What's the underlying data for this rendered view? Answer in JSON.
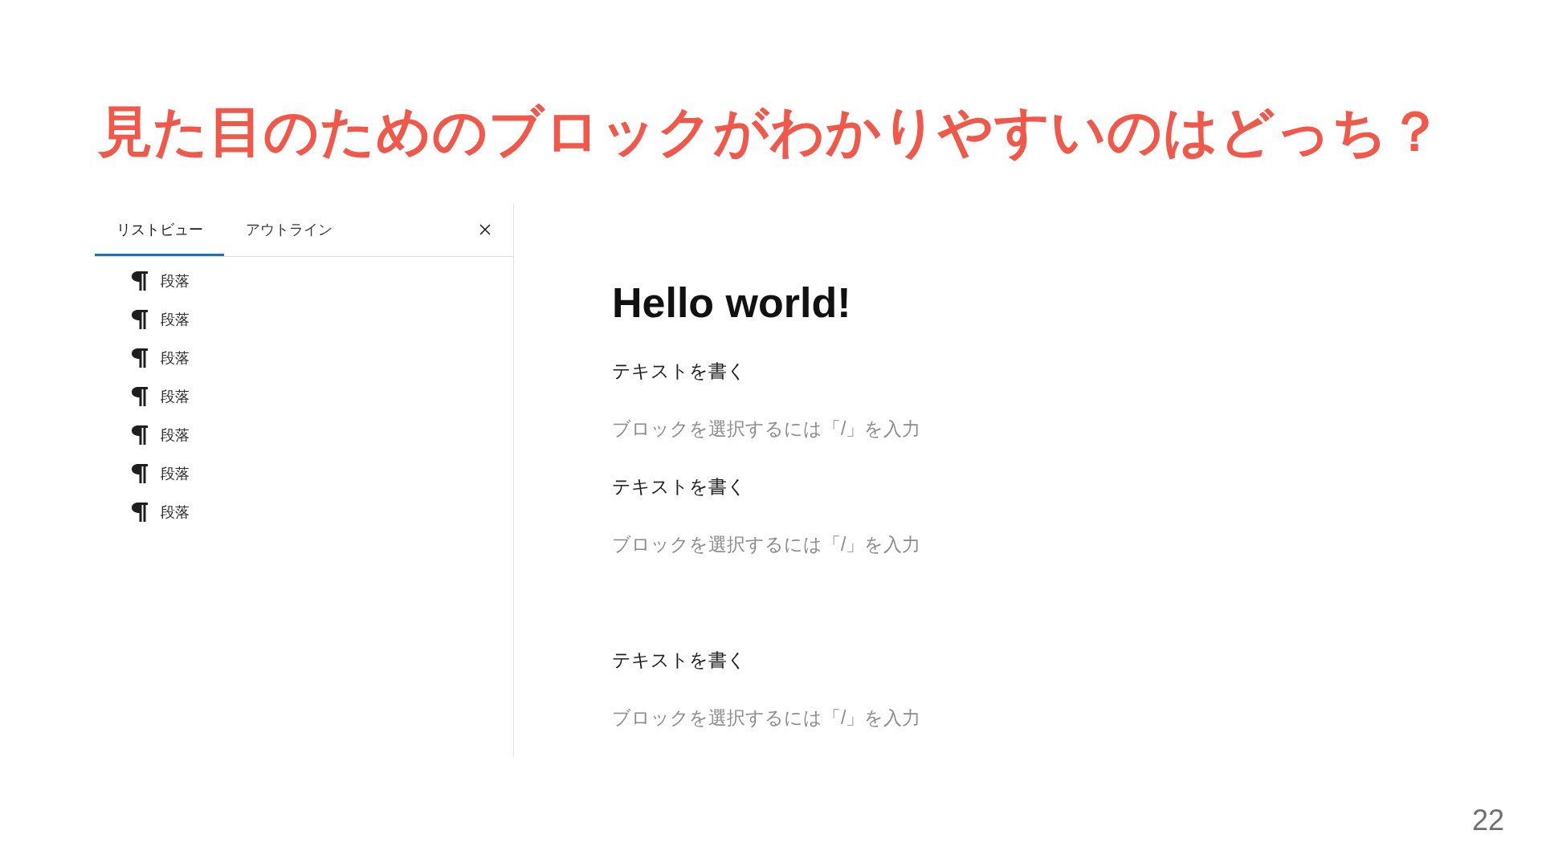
{
  "title": "見た目のためのブロックがわかりやすいのはどっち？",
  "list_view": {
    "tabs": [
      {
        "label": "リストビュー",
        "selected": true
      },
      {
        "label": "アウトライン",
        "selected": false
      }
    ],
    "items": [
      {
        "label": "段落",
        "selected": false
      },
      {
        "label": "段落",
        "selected": false
      },
      {
        "label": "段落",
        "selected": false
      },
      {
        "label": "段落",
        "selected": false
      },
      {
        "label": "段落",
        "selected": false
      },
      {
        "label": "段落",
        "selected": false
      },
      {
        "label": "段落",
        "selected": false
      }
    ]
  },
  "editor": {
    "blocks": [
      {
        "kind": "heading",
        "text": "Hello world!"
      },
      {
        "kind": "paragraph",
        "text": "テキストを書く"
      },
      {
        "kind": "empty_paragraph",
        "placeholder": "ブロックを選択するには「/」を入力"
      },
      {
        "kind": "paragraph",
        "text": "テキストを書く"
      },
      {
        "kind": "empty_paragraph",
        "placeholder": "ブロックを選択するには「/」を入力"
      },
      {
        "kind": "gap"
      },
      {
        "kind": "paragraph",
        "text": "テキストを書く"
      },
      {
        "kind": "empty_paragraph",
        "placeholder": "ブロックを選択するには「/」を入力"
      }
    ]
  },
  "page_number": "22"
}
